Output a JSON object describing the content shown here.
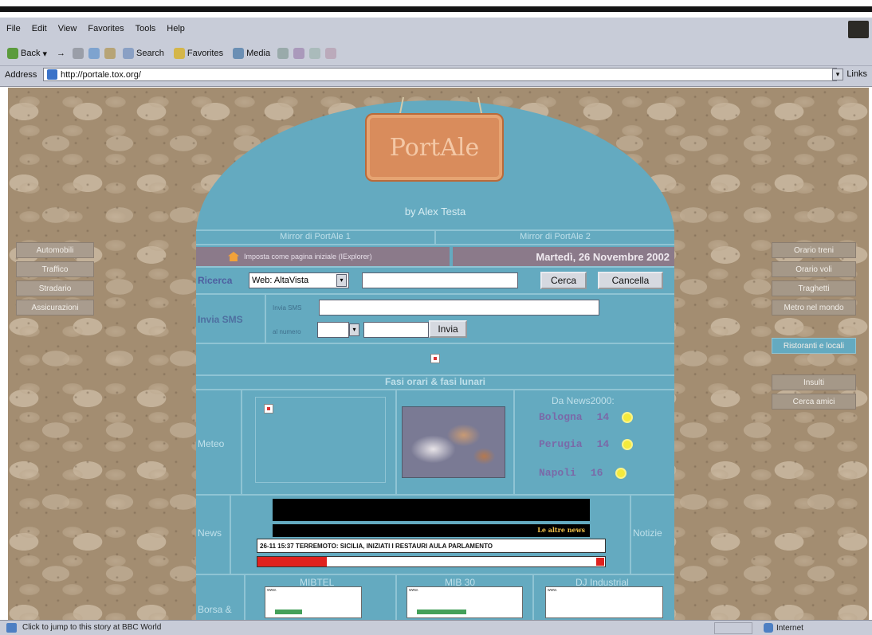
{
  "browser": {
    "menu": [
      "File",
      "Edit",
      "View",
      "Favorites",
      "Tools",
      "Help"
    ],
    "toolbar": {
      "back": "Back",
      "search": "Search",
      "favorites": "Favorites",
      "media": "Media"
    },
    "address_label": "Address",
    "url": "http://portale.tox.org/",
    "links_label": "Links",
    "status_text": "Click to jump to this story at BBC World",
    "zone": "Internet"
  },
  "portal": {
    "sign_title": "PortAle",
    "byline": "by Alex Testa",
    "mirror1": "Mirror di PortAle 1",
    "mirror2": "Mirror di PortAle 2",
    "homepage_link": "Imposta come pagina iniziale (IExplorer)",
    "date": "Martedì, 26 Novembre 2002",
    "search_label": "Ricerca",
    "search_engine": "Web: AltaVista",
    "search_button": "Cerca",
    "cancel_button": "Cancella",
    "sms_label": "Invia SMS",
    "sms_text_label": "Invia SMS",
    "sms_number_label": "al numero",
    "sms_send_button": "Invia",
    "fasi_title": "Fasi orari & fasi lunari",
    "meteo_label": "Meteo",
    "news2000_label": "Da News2000:",
    "cities": [
      {
        "name": "Bologna",
        "temp": "14"
      },
      {
        "name": "Perugia",
        "temp": "14"
      },
      {
        "name": "Napoli",
        "temp": "16"
      }
    ],
    "news_label": "News",
    "altre_news": "Le altre news",
    "ticker": "26-11 15:37 TERREMOTO: SICILIA, INIZIATI I RESTAURI AULA PARLAMENTO",
    "notizie_label": "Notizie",
    "borsa_label": "Borsa &",
    "markets": [
      "MIBTEL",
      "MIB 30",
      "DJ Industrial"
    ]
  },
  "left_nav": [
    "Automobili",
    "Traffico",
    "Stradario",
    "Assicurazioni"
  ],
  "right_nav": [
    "Orario treni",
    "Orario voli",
    "Traghetti",
    "Metro nel mondo",
    "Ristoranti e locali",
    "Insulti",
    "Cerca amici"
  ],
  "colors": {
    "panel": "#64aac0",
    "accent_purple": "#8b7a8a",
    "stone": "#a38d71"
  }
}
